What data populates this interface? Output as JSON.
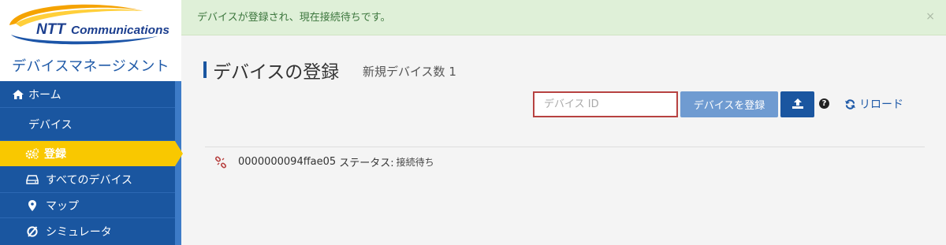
{
  "brand": {
    "logo_text": "NTTCommunications",
    "app_title": "デバイスマネージメント"
  },
  "sidebar": {
    "items": [
      {
        "label": "ホーム",
        "icon": "home-icon",
        "active": false
      },
      {
        "label": "デバイス",
        "icon": "",
        "active": false
      },
      {
        "label": "登録",
        "icon": "gears-icon",
        "active": true
      },
      {
        "label": "すべてのデバイス",
        "icon": "hdd-icon",
        "active": false
      },
      {
        "label": "マップ",
        "icon": "map-marker-icon",
        "active": false
      },
      {
        "label": "シミュレータ",
        "icon": "simulator-icon",
        "active": false
      }
    ]
  },
  "alert": {
    "message": "デバイスが登録され、現在接続待ちです。",
    "close": "×"
  },
  "page": {
    "title": "デバイスの登録",
    "subtitle": "新規デバイス数 1"
  },
  "toolbar": {
    "input_placeholder": "デバイス ID",
    "input_value": "",
    "register_label": "デバイスを登録",
    "help_label": "?",
    "reload_label": "リロード"
  },
  "devices": [
    {
      "id": "0000000094ffae05",
      "status_label": "ステータス:",
      "status": "接続待ち"
    }
  ],
  "colors": {
    "nav_bg": "#1a56a0",
    "active": "#f9c800",
    "alert_bg": "#dff0d8",
    "alert_text": "#3c763d",
    "register_btn": "#6f9bd1",
    "input_border": "#b74241"
  }
}
